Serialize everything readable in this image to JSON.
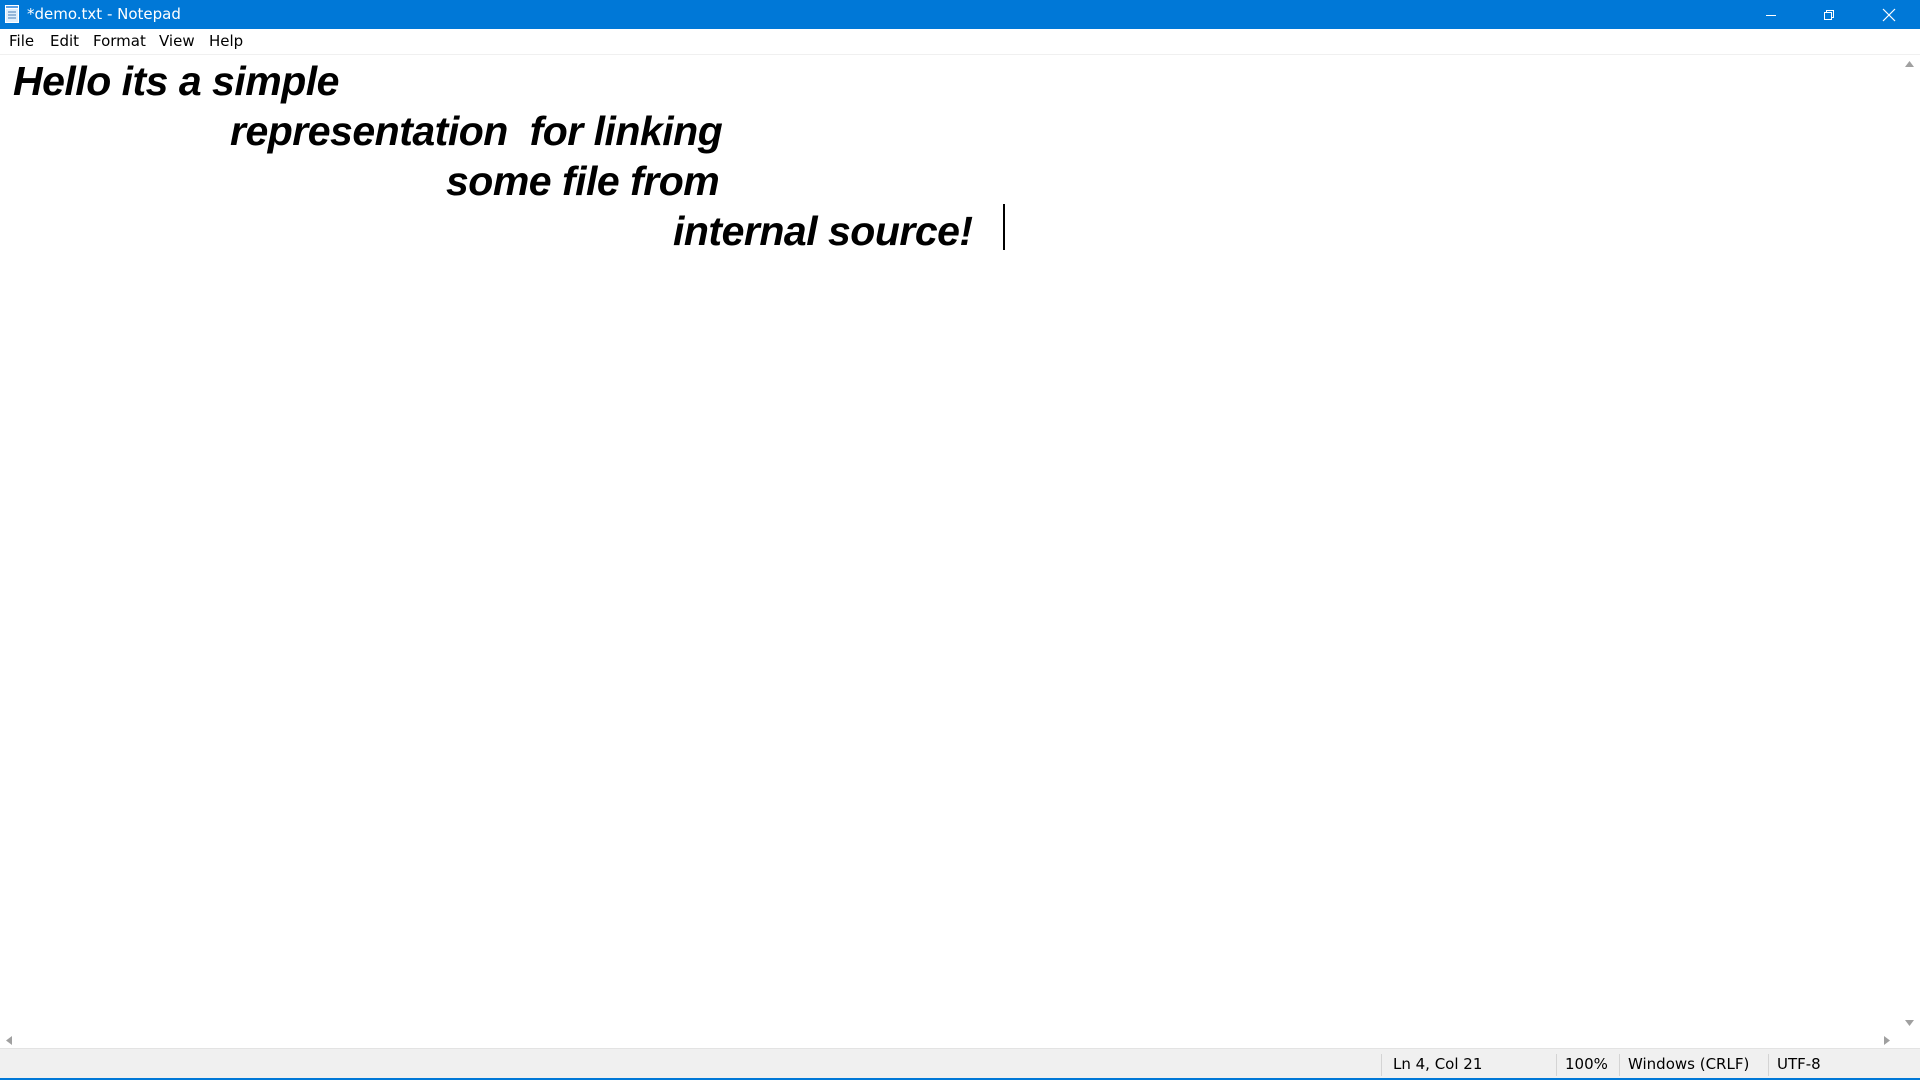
{
  "window": {
    "title": "*demo.txt - Notepad",
    "accent_color": "#0078d7",
    "icon": "notepad-icon"
  },
  "caption_buttons": {
    "minimize_icon": "minimize-icon",
    "restore_icon": "restore-icon",
    "close_icon": "close-icon"
  },
  "menu": {
    "items": [
      {
        "label": "File"
      },
      {
        "label": "Edit"
      },
      {
        "label": "Format"
      },
      {
        "label": "View"
      },
      {
        "label": "Help"
      }
    ]
  },
  "editor": {
    "lines": [
      "Hello its a simple",
      "representation  for linking",
      "some file from",
      "internal source!"
    ]
  },
  "statusbar": {
    "position": "Ln 4, Col 21",
    "zoom": "100%",
    "line_endings": "Windows (CRLF)",
    "encoding": "UTF-8"
  }
}
